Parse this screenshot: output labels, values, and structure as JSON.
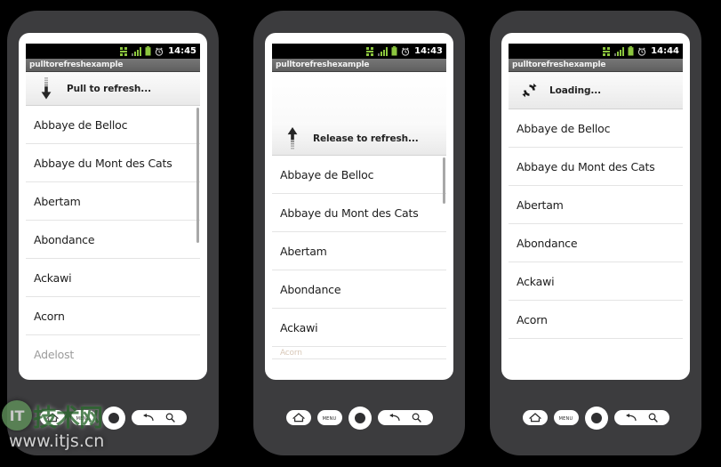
{
  "app": {
    "title": "pulltorefreshexample",
    "cheese_list": [
      "Abbaye de Belloc",
      "Abbaye du Mont des Cats",
      "Abertam",
      "Abondance",
      "Ackawi",
      "Acorn",
      "Adelost"
    ]
  },
  "phones": [
    {
      "id": "phone-pull",
      "status_bar": {
        "time": "14:45"
      },
      "title": "pulltorefreshexample",
      "refresh_header": {
        "state": "pull",
        "label": "Pull to refresh...",
        "icon": "arrow-down-icon"
      },
      "rows": [
        "Abbaye de Belloc",
        "Abbaye du Mont des Cats",
        "Abertam",
        "Abondance",
        "Ackawi",
        "Acorn",
        "Adelost"
      ]
    },
    {
      "id": "phone-release",
      "status_bar": {
        "time": "14:43"
      },
      "title": "pulltorefreshexample",
      "refresh_header": {
        "state": "release",
        "label": "Release to refresh...",
        "icon": "arrow-up-icon"
      },
      "rows": [
        "Abbaye de Belloc",
        "Abbaye du Mont des Cats",
        "Abertam",
        "Abondance",
        "Ackawi",
        "Acorn"
      ]
    },
    {
      "id": "phone-loading",
      "status_bar": {
        "time": "14:44"
      },
      "title": "pulltorefreshexample",
      "refresh_header": {
        "state": "loading",
        "label": "Loading...",
        "icon": "refresh-spinner-icon"
      },
      "rows": [
        "Abbaye de Belloc",
        "Abbaye du Mont des Cats",
        "Abertam",
        "Abondance",
        "Ackawi",
        "Acorn"
      ]
    }
  ],
  "hardware_keys": {
    "home": "home-icon",
    "menu_label": "menu",
    "trackball": "trackball",
    "back": "back-arrow-icon",
    "search": "search-icon"
  },
  "watermark": {
    "badge": "IT",
    "chinese": "技术网",
    "url": "www.itjs.cn"
  },
  "colors": {
    "bezel": "#3c3c3e",
    "titlebar": "#6b6b6b",
    "statusbar": "#000000",
    "accent_green": "#8cc63e",
    "list_text": "#1d1d1d"
  }
}
